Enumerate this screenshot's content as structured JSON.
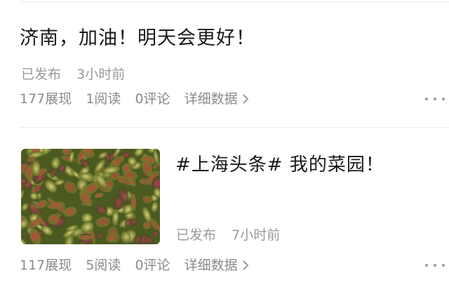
{
  "posts": [
    {
      "title": "济南，加油！明天会更好！",
      "status": "已发布",
      "time": "3小时前",
      "views": "177展现",
      "reads": "1阅读",
      "comments": "0评论",
      "detail_label": "详细数据"
    },
    {
      "title": "#上海头条# 我的菜园！",
      "status": "已发布",
      "time": "7小时前",
      "views": "117展现",
      "reads": "5阅读",
      "comments": "0评论",
      "detail_label": "详细数据",
      "thumbnail": "garden-photo"
    }
  ],
  "icons": {
    "detail_arrow": "chevron-right-icon",
    "more": "more-dots-icon"
  }
}
